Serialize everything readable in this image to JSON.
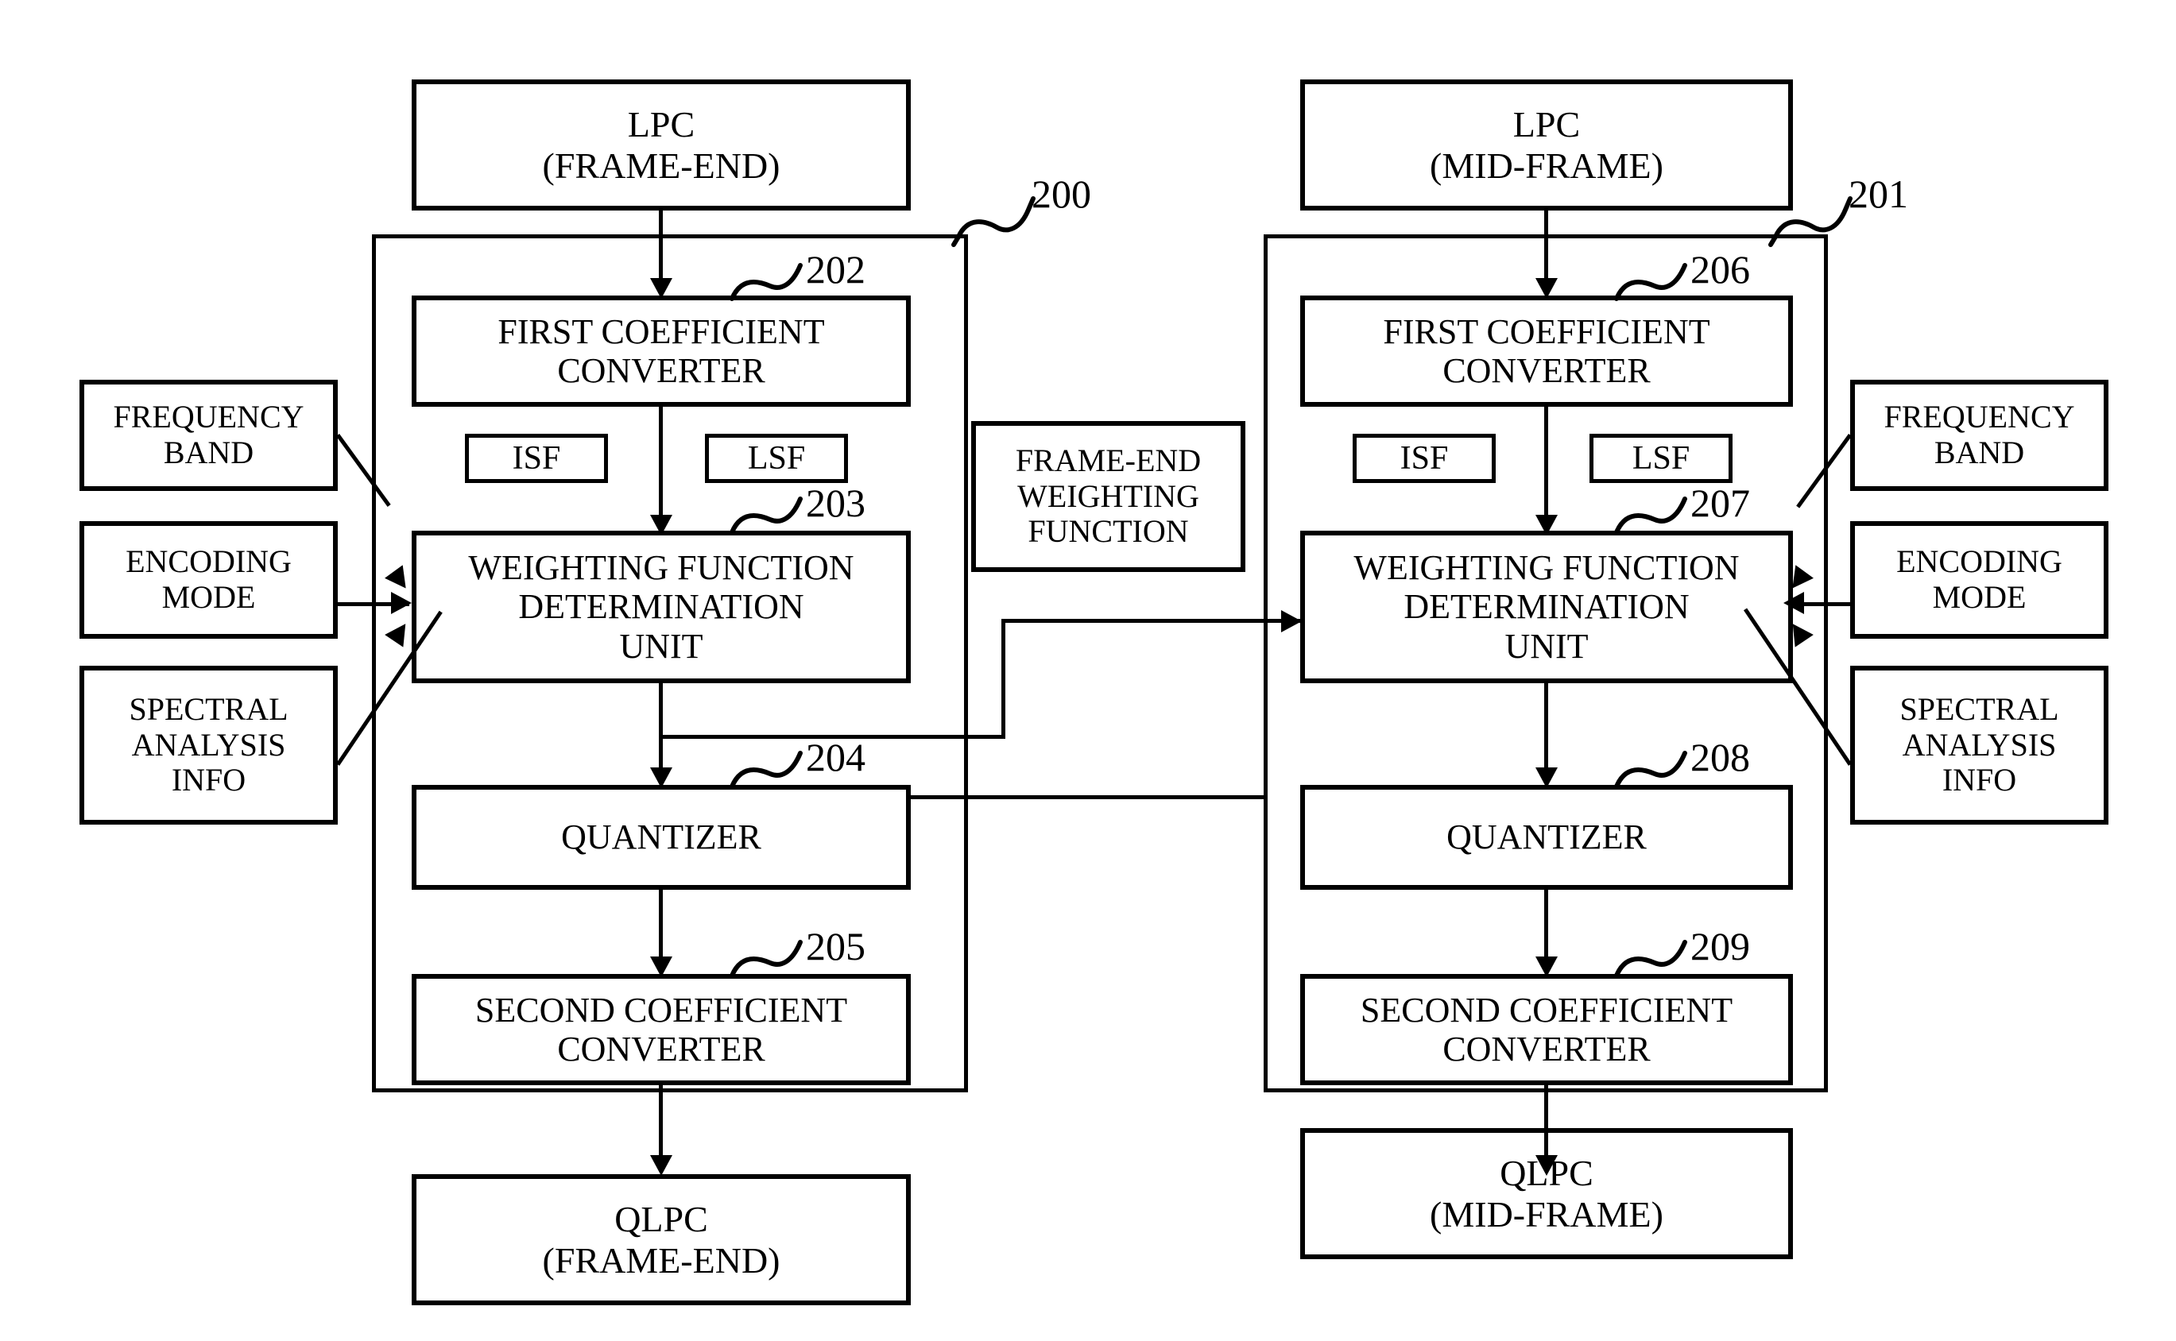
{
  "figure": {
    "type": "patent-block-diagram",
    "description": "LPC quantization apparatus block diagram with frame-end and mid-frame paths"
  },
  "groups": [
    {
      "ref": "200",
      "name": "frame-end-group"
    },
    {
      "ref": "201",
      "name": "mid-frame-group"
    }
  ],
  "left_column": {
    "input": {
      "line1": "LPC",
      "line2": "(FRAME-END)"
    },
    "blocks": [
      {
        "ref": "202",
        "line1": "FIRST COEFFICIENT",
        "line2": "CONVERTER"
      },
      {
        "ref": "203",
        "line1": "WEIGHTING FUNCTION",
        "line2": "DETERMINATION",
        "line3": "UNIT"
      },
      {
        "ref": "204",
        "line1": "QUANTIZER"
      },
      {
        "ref": "205",
        "line1": "SECOND COEFFICIENT",
        "line2": "CONVERTER"
      }
    ],
    "chips": [
      "ISF",
      "LSF"
    ],
    "output": {
      "line1": "QLPC",
      "line2": "(FRAME-END)"
    }
  },
  "right_column": {
    "input": {
      "line1": "LPC",
      "line2": "(MID-FRAME)"
    },
    "blocks": [
      {
        "ref": "206",
        "line1": "FIRST COEFFICIENT",
        "line2": "CONVERTER"
      },
      {
        "ref": "207",
        "line1": "WEIGHTING FUNCTION",
        "line2": "DETERMINATION",
        "line3": "UNIT"
      },
      {
        "ref": "208",
        "line1": "QUANTIZER"
      },
      {
        "ref": "209",
        "line1": "SECOND COEFFICIENT",
        "line2": "CONVERTER"
      }
    ],
    "chips": [
      "ISF",
      "LSF"
    ],
    "output": {
      "line1": "QLPC",
      "line2": "(MID-FRAME)"
    }
  },
  "left_inputs": [
    {
      "line1": "FREQUENCY",
      "line2": "BAND"
    },
    {
      "line1": "ENCODING",
      "line2": "MODE"
    },
    {
      "line1": "SPECTRAL",
      "line2": "ANALYSIS",
      "line3": "INFO"
    }
  ],
  "right_inputs": [
    {
      "line1": "FREQUENCY",
      "line2": "BAND"
    },
    {
      "line1": "ENCODING",
      "line2": "MODE"
    },
    {
      "line1": "SPECTRAL",
      "line2": "ANALYSIS",
      "line3": "INFO"
    }
  ],
  "middle_signal": {
    "line1": "FRAME-END",
    "line2": "WEIGHTING",
    "line3": "FUNCTION"
  },
  "colors": {
    "ink": "#000000",
    "paper": "#ffffff"
  }
}
